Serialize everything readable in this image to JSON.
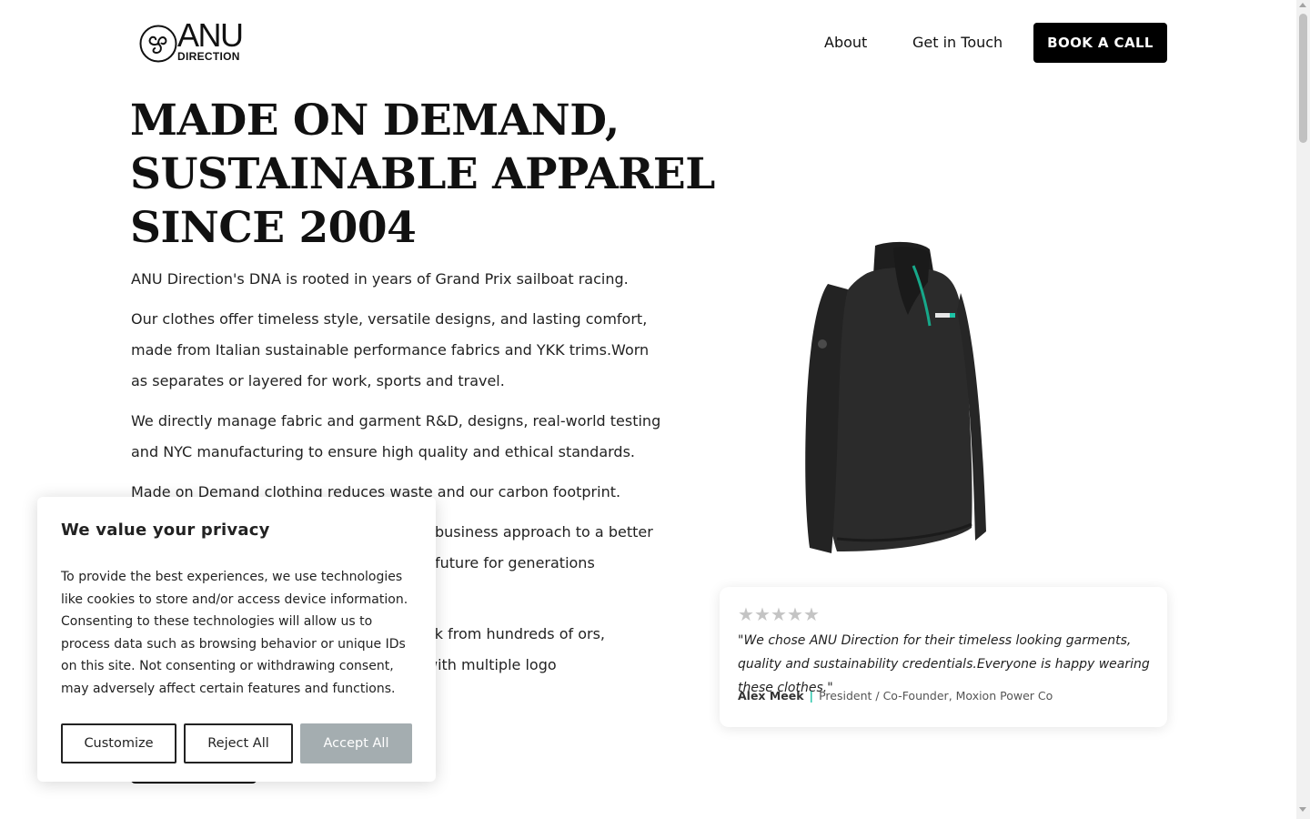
{
  "brand": {
    "name_top": "ANU",
    "name_bottom": "DIRECTION"
  },
  "nav": {
    "items": [
      {
        "label": "About"
      },
      {
        "label": "Get in Touch"
      }
    ],
    "cta_label": "BOOK A CALL"
  },
  "hero": {
    "headline_lines": [
      "MADE ON DEMAND,",
      "SUSTAINABLE APPAREL",
      "SINCE 2004"
    ],
    "paragraphs": [
      "ANU Direction's DNA is rooted in years of Grand Prix sailboat racing.",
      "Our clothes offer timeless style, versatile designs, and lasting comfort, made from Italian sustainable performance fabrics and YKK trims.Worn as separates or layered for work, sports and travel.",
      "We directly manage fabric and garment  R&D, designs, real-world testing and NYC manufacturing to ensure high quality and ethical standards.",
      "Made on Demand clothing reduces waste and our carbon footprint.",
      "business approach to a better future for generations",
      "ok  from hundreds of ors, with multiple logo"
    ]
  },
  "product": {
    "alt": "Black quarter-zip pullover jacket with teal zipper"
  },
  "testimonial": {
    "rating": 0,
    "max_rating": 5,
    "star_color": "#c4c4c4",
    "quote": "\"We chose ANU Direction for their timeless looking garments, quality and sustainability credentials.Everyone is happy wearing these clothes.\"",
    "author_name": "Alex Meek",
    "separator": "|",
    "author_title": "President / Co-Founder, Moxion Power Co",
    "accent_color": "#1ec3a6"
  },
  "cookie_banner": {
    "title": "We value your privacy",
    "body": "To provide the best experiences, we use technologies like cookies to store and/or access device information. Consenting to these technologies will allow us to process data such as browsing behavior or unique IDs on this site. Not consenting or withdrawing consent, may adversely affect certain features and functions.",
    "customize_label": "Customize",
    "reject_label": "Reject All",
    "accept_label": "Accept All",
    "accept_color": "#a4adb0"
  }
}
